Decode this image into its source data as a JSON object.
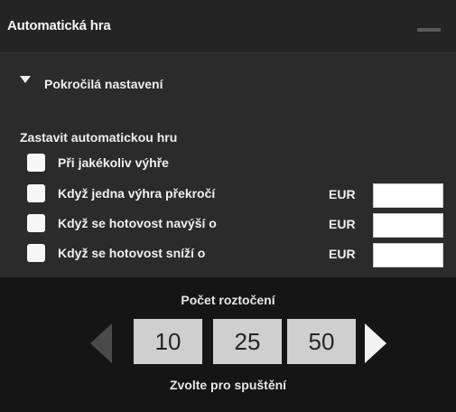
{
  "header": {
    "title": "Automatická hra",
    "minimize_icon": "minimize-icon"
  },
  "advanced": {
    "label": "Pokročilá nastavení",
    "icon": "triangle-down-icon",
    "expanded": true
  },
  "stop": {
    "title": "Zastavit automatickou hru",
    "options": [
      {
        "label": "Při jakékoliv výhře",
        "checked": false
      },
      {
        "label": "Když jedna výhra překročí",
        "checked": false,
        "currency": "EUR",
        "value": ""
      },
      {
        "label": "Když se hotovost navýší o",
        "checked": false,
        "currency": "EUR",
        "value": ""
      },
      {
        "label": "Když se hotovost sníží o",
        "checked": false,
        "currency": "EUR",
        "value": ""
      }
    ]
  },
  "spins": {
    "title": "Počet roztočení",
    "options": [
      "10",
      "25",
      "50"
    ],
    "hint": "Zvolte pro spuštění",
    "prev_icon": "arrow-left-icon",
    "next_icon": "arrow-right-icon"
  },
  "colors": {
    "panel": "#2b2b2b",
    "bottom": "#151515",
    "button": "#cfcfcf",
    "arrow_disabled": "#4a4a4a",
    "arrow_enabled": "#f2f2f2"
  }
}
